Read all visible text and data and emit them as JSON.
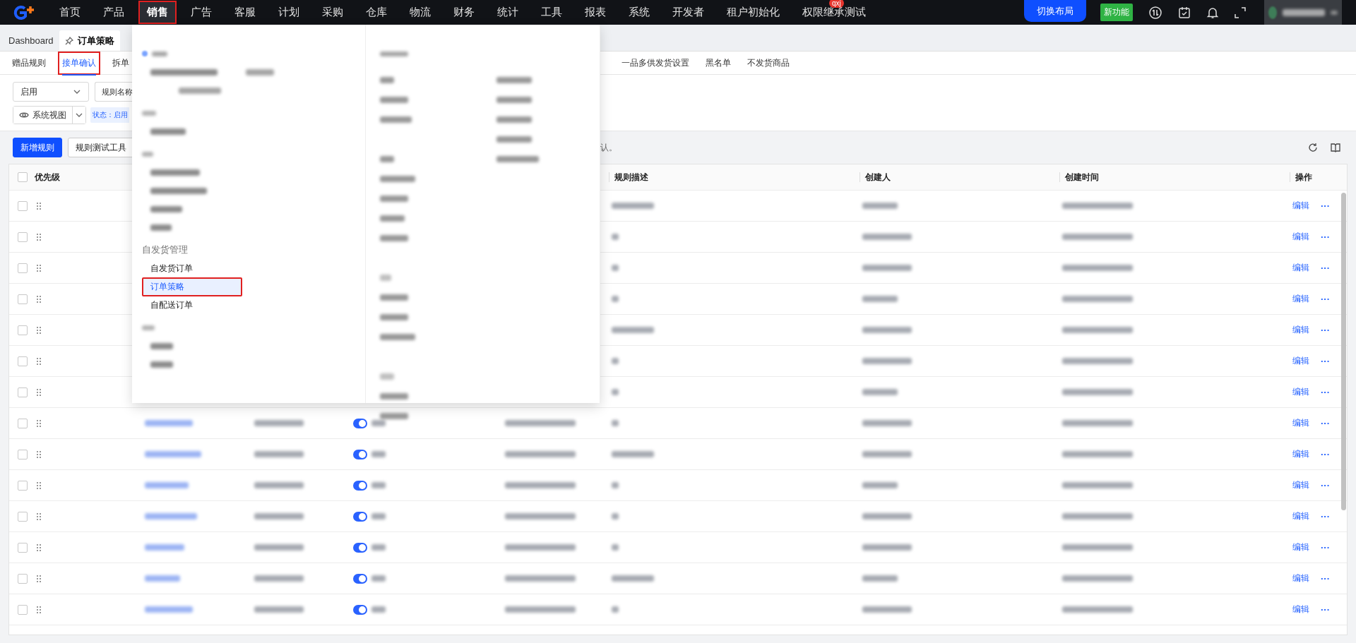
{
  "topbar": {
    "nav": [
      {
        "label": "首页",
        "selected": false,
        "highlighted": false
      },
      {
        "label": "产品",
        "selected": false,
        "highlighted": false
      },
      {
        "label": "销售",
        "selected": true,
        "highlighted": true
      },
      {
        "label": "广告",
        "selected": false,
        "highlighted": false
      },
      {
        "label": "客服",
        "selected": false,
        "highlighted": false
      },
      {
        "label": "计划",
        "selected": false,
        "highlighted": false
      },
      {
        "label": "采购",
        "selected": false,
        "highlighted": false
      },
      {
        "label": "仓库",
        "selected": false,
        "highlighted": false
      },
      {
        "label": "物流",
        "selected": false,
        "highlighted": false
      },
      {
        "label": "财务",
        "selected": false,
        "highlighted": false
      },
      {
        "label": "统计",
        "selected": false,
        "highlighted": false
      },
      {
        "label": "工具",
        "selected": false,
        "highlighted": false
      },
      {
        "label": "报表",
        "selected": false,
        "highlighted": false
      },
      {
        "label": "系统",
        "selected": false,
        "highlighted": false
      },
      {
        "label": "开发者",
        "selected": false,
        "highlighted": false
      },
      {
        "label": "租户初始化",
        "selected": false,
        "highlighted": false
      },
      {
        "label": "权限继承测试",
        "selected": false,
        "highlighted": false,
        "badge": "qxj"
      }
    ],
    "switch_layout": "切换布局",
    "new_feature": "新功能"
  },
  "page_tabs": [
    {
      "label": "Dashboard",
      "selected": false
    },
    {
      "label": "订单策略",
      "selected": true
    }
  ],
  "sub_tabs": [
    {
      "label": "赠品规则",
      "selected": false,
      "highlighted": false
    },
    {
      "label": "接单确认",
      "selected": true,
      "highlighted": true
    },
    {
      "label": "拆单",
      "selected": false,
      "highlighted": false
    },
    {
      "label": "一品多供发货设置",
      "selected": false,
      "highlighted": false
    },
    {
      "label": "黑名单",
      "selected": false,
      "highlighted": false
    },
    {
      "label": "不发货商品",
      "selected": false,
      "highlighted": false
    }
  ],
  "filters": {
    "status_select": "启用",
    "name_field": "规则名称",
    "view_button": "系统视图",
    "status_tag": "状态：启用"
  },
  "toolbar": {
    "buttons": [
      "新增规则",
      "规则测试工具"
    ],
    "hint": "认。"
  },
  "menu": {
    "group_title": "自发货管理",
    "items": [
      {
        "label": "自发货订单",
        "selected": false,
        "highlighted": false
      },
      {
        "label": "订单策略",
        "selected": true,
        "highlighted": true
      },
      {
        "label": "自配送订单",
        "selected": false,
        "highlighted": false
      }
    ]
  },
  "table": {
    "all_checked": false,
    "columns": [
      "优先级",
      "规则描述",
      "创建人",
      "创建时间",
      "操作"
    ],
    "rows": [
      {
        "checked": false,
        "edit": "编辑",
        "more": "···"
      },
      {
        "checked": false,
        "edit": "编辑",
        "more": "···"
      },
      {
        "checked": false,
        "edit": "编辑",
        "more": "···"
      },
      {
        "checked": false,
        "edit": "编辑",
        "more": "···"
      },
      {
        "checked": false,
        "edit": "编辑",
        "more": "···"
      },
      {
        "checked": false,
        "edit": "编辑",
        "more": "···"
      },
      {
        "checked": false,
        "edit": "编辑",
        "more": "···"
      },
      {
        "checked": false,
        "edit": "编辑",
        "more": "···",
        "on": true
      },
      {
        "checked": false,
        "edit": "编辑",
        "more": "···",
        "on": true
      },
      {
        "checked": false,
        "edit": "编辑",
        "more": "···",
        "on": true
      },
      {
        "checked": false,
        "edit": "编辑",
        "more": "···",
        "on": true
      },
      {
        "checked": false,
        "edit": "编辑",
        "more": "···",
        "on": true
      },
      {
        "checked": false,
        "edit": "编辑",
        "more": "···",
        "on": true
      },
      {
        "checked": false,
        "edit": "编辑",
        "more": "···",
        "on": true
      }
    ]
  }
}
